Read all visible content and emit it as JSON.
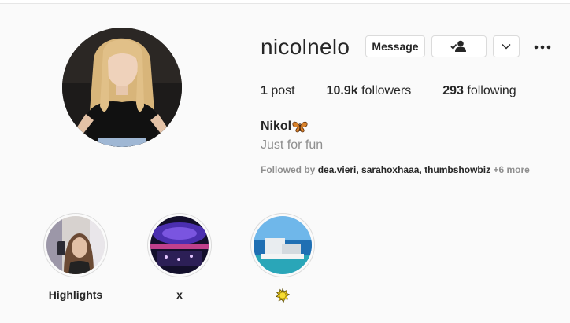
{
  "profile": {
    "username": "nicolnelo",
    "display_name": "Nikol",
    "bio": "Just for fun",
    "stats": {
      "posts_count": "1",
      "posts_label": "post",
      "followers_count": "10.9k",
      "followers_label": "followers",
      "following_count": "293",
      "following_label": "following"
    },
    "followed_by": {
      "prefix": "Followed by",
      "names": "dea.vieri, sarahoxhaaa, thumbshowbiz",
      "more": "+6 more"
    }
  },
  "actions": {
    "message_label": "Message",
    "follow_icon": "person-check-icon",
    "dropdown_icon": "chevron-down-icon",
    "more_icon": "more-dots-icon"
  },
  "highlights": [
    {
      "label": "Highlights"
    },
    {
      "label": "x"
    },
    {
      "label": "sun-emoji"
    }
  ],
  "colors": {
    "background": "#fafafa",
    "text": "#262626",
    "muted": "#8e8e8e",
    "border": "#dbdbdb"
  }
}
